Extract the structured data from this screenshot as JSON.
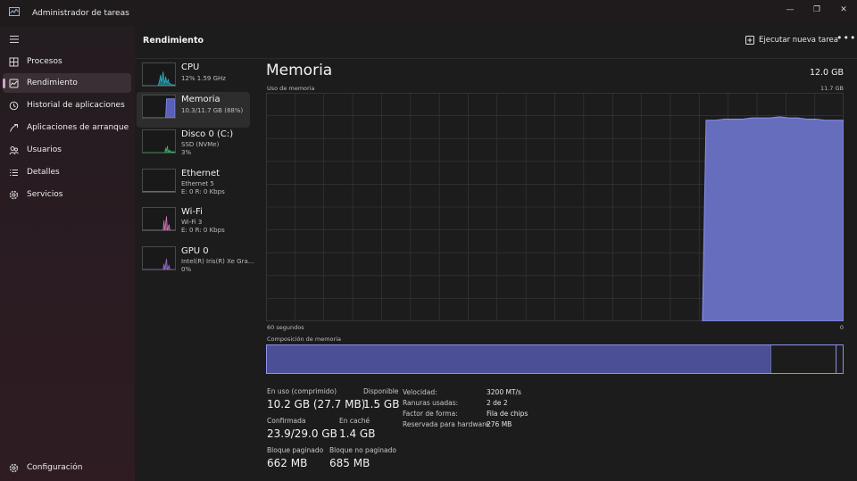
{
  "window": {
    "title": "Administrador de tareas",
    "controls": {
      "minimize": "—",
      "maximize": "❐",
      "close": "✕"
    }
  },
  "sidebar": {
    "items": [
      {
        "label": "Procesos",
        "icon": "processes-icon"
      },
      {
        "label": "Rendimiento",
        "icon": "performance-icon",
        "active": true
      },
      {
        "label": "Historial de aplicaciones",
        "icon": "history-icon"
      },
      {
        "label": "Aplicaciones de arranque",
        "icon": "startup-icon"
      },
      {
        "label": "Usuarios",
        "icon": "users-icon"
      },
      {
        "label": "Detalles",
        "icon": "details-icon"
      },
      {
        "label": "Servicios",
        "icon": "services-icon"
      }
    ],
    "settings_label": "Configuración"
  },
  "header": {
    "title": "Rendimiento",
    "new_task_label": "Ejecutar nueva tarea",
    "more": "•••"
  },
  "devices": [
    {
      "name": "CPU",
      "sub": [
        "12%  1.59 GHz"
      ],
      "color": "#29b6c8"
    },
    {
      "name": "Memoria",
      "sub": [
        "10.3/11.7 GB (88%)"
      ],
      "color": "#7b83e0",
      "active": true
    },
    {
      "name": "Disco 0 (C:)",
      "sub": [
        "SSD (NVMe)",
        "3%"
      ],
      "color": "#3fb86e"
    },
    {
      "name": "Ethernet",
      "sub": [
        "Ethernet 5",
        "E: 0 R: 0 Kbps"
      ],
      "color": "#c86e3f"
    },
    {
      "name": "Wi-Fi",
      "sub": [
        "Wi-Fi 3",
        "E: 0 R: 0 Kbps"
      ],
      "color": "#d07ab8"
    },
    {
      "name": "GPU 0",
      "sub": [
        "Intel(R) Iris(R) Xe Gra...",
        "0%"
      ],
      "color": "#a06ed0"
    }
  ],
  "memory": {
    "title": "Memoria",
    "total": "12.0 GB",
    "usage_label": "Uso de memoria",
    "usage_max": "11.7 GB",
    "time_left": "60 segundos",
    "time_right": "0",
    "composition_label": "Composición de memoria",
    "in_use_fraction": 0.872,
    "free_fraction": 0.115,
    "stats": {
      "in_use_label": "En uso (comprimido)",
      "in_use_value": "10.2 GB (27.7 MB)",
      "available_label": "Disponible",
      "available_value": "1.5 GB",
      "committed_label": "Confirmada",
      "committed_value": "23.9/29.0 GB",
      "cached_label": "En caché",
      "cached_value": "1.4 GB",
      "paged_label": "Bloque paginado",
      "paged_value": "662 MB",
      "nonpaged_label": "Bloque no paginado",
      "nonpaged_value": "685 MB"
    },
    "props": [
      {
        "label": "Velocidad:",
        "value": "3200 MT/s"
      },
      {
        "label": "Ranuras usadas:",
        "value": "2 de 2"
      },
      {
        "label": "Factor de forma:",
        "value": "Fila de chips"
      },
      {
        "label": "Reservada para hardware:",
        "value": "276 MB"
      }
    ],
    "series_fraction": [
      0,
      0,
      0,
      0,
      0,
      0,
      0,
      0,
      0,
      0,
      0,
      0,
      0,
      0,
      0,
      0,
      0,
      0,
      0,
      0,
      0,
      0,
      0,
      0,
      0,
      0,
      0,
      0,
      0,
      0,
      0,
      0,
      0,
      0,
      0,
      0,
      0,
      0,
      0,
      0,
      0,
      0,
      0,
      0,
      0,
      0,
      0,
      0,
      0.88,
      0.88,
      0.885,
      0.885,
      0.885,
      0.89,
      0.89,
      0.89,
      0.895,
      0.89,
      0.89,
      0.885,
      0.885,
      0.88,
      0.88,
      0.88
    ]
  },
  "colors": {
    "accent": "#7b83e0",
    "memory_fill": "#6a72c6",
    "memory_line": "#8b93ee",
    "grid": "#3a3a3a"
  }
}
